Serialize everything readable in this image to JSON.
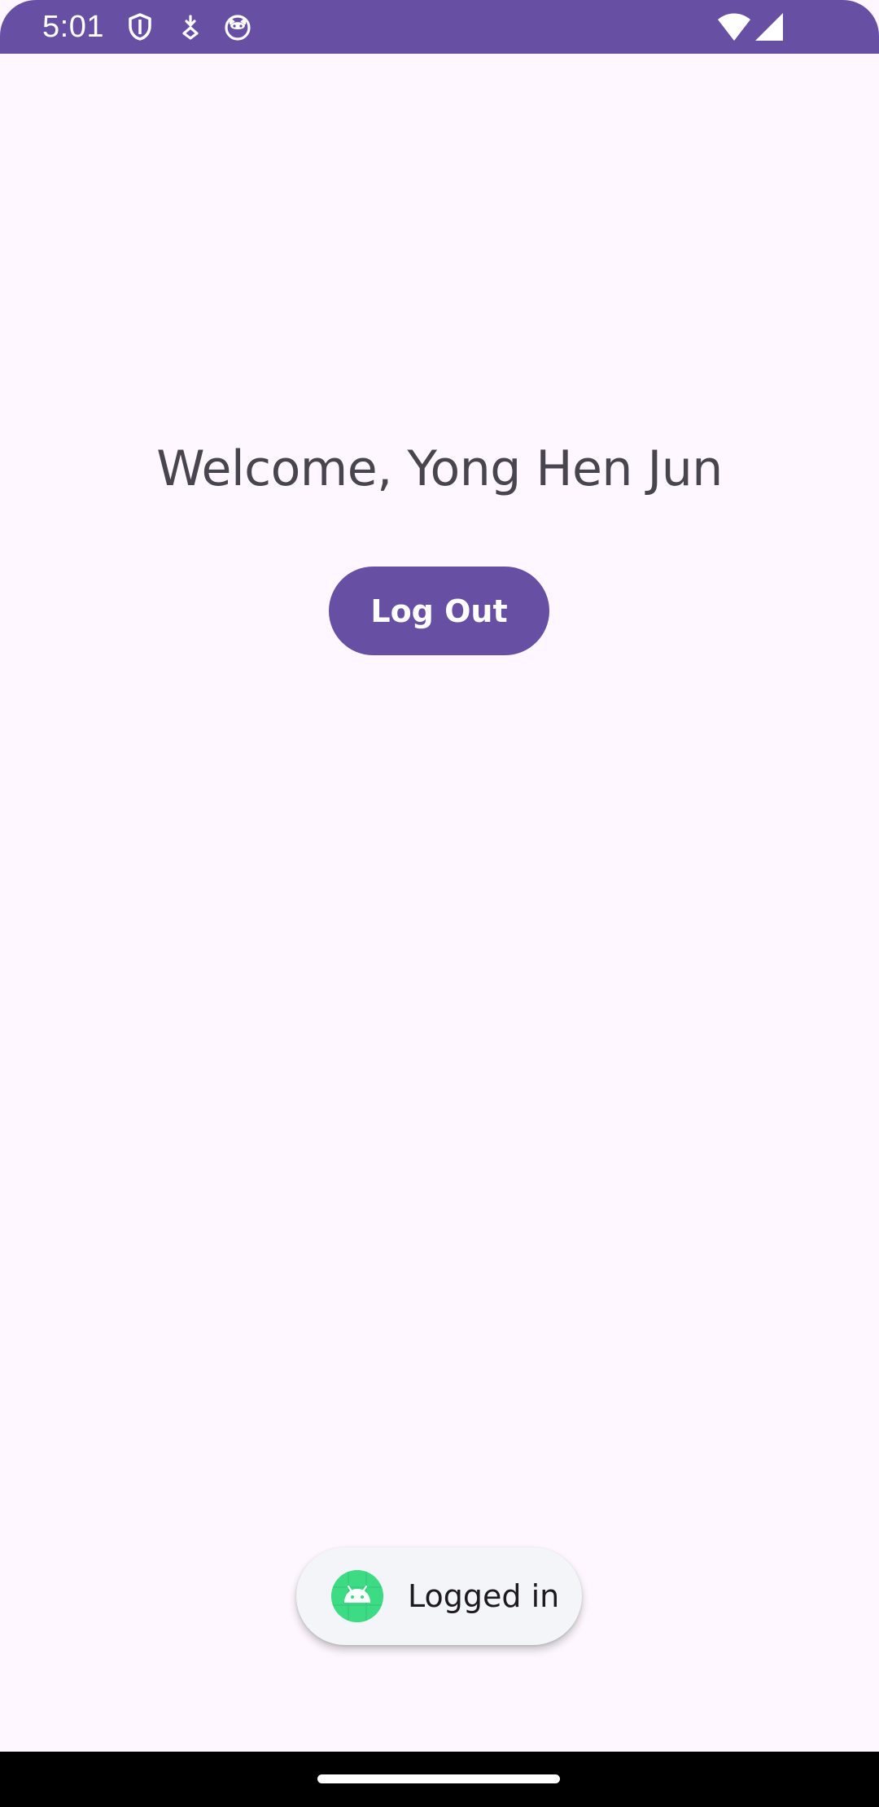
{
  "status_bar": {
    "time": "5:01",
    "background": "#6750A4",
    "icons_left": [
      "shield-icon",
      "download-icon",
      "cat-icon"
    ],
    "icons_right": [
      "wifi-icon",
      "cellular-signal-icon"
    ]
  },
  "main": {
    "welcome_text": "Welcome, Yong Hen Jun",
    "logout_label": "Log Out"
  },
  "toast": {
    "icon": "android-icon",
    "message": "Logged in"
  },
  "colors": {
    "primary": "#6750A4",
    "background": "#FEF7FF",
    "on_surface_variant": "#49454F",
    "toast_background": "#F3F5F9",
    "android_green": "#3DDC84"
  }
}
